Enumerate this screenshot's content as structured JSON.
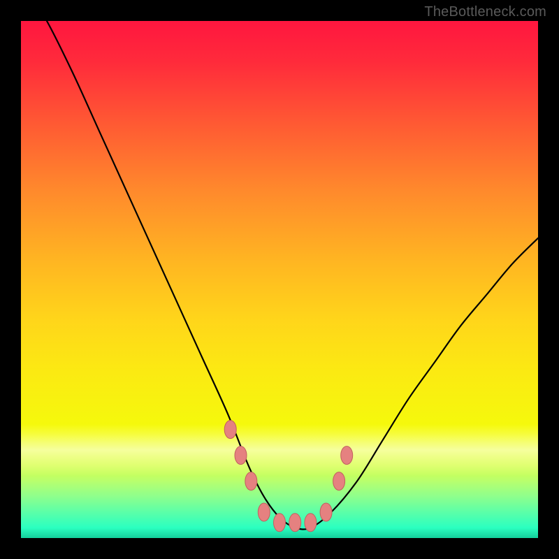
{
  "watermark": {
    "text": "TheBottleneck.com"
  },
  "colors": {
    "curve_stroke": "#000000",
    "marker_fill": "#e58180",
    "marker_stroke": "#c25f5e",
    "background_frame": "#000000"
  },
  "chart_data": {
    "type": "line",
    "title": "",
    "xlabel": "",
    "ylabel": "",
    "xlim": [
      0,
      100
    ],
    "ylim": [
      0,
      100
    ],
    "grid": false,
    "legend": false,
    "series": [
      {
        "name": "bottleneck-curve",
        "x": [
          0,
          5,
          10,
          15,
          20,
          25,
          30,
          35,
          40,
          44,
          47,
          50,
          53,
          56,
          60,
          65,
          70,
          75,
          80,
          85,
          90,
          95,
          100
        ],
        "values": [
          108,
          100,
          90,
          79,
          68,
          57,
          46,
          35,
          24,
          14,
          8,
          4,
          2,
          2,
          5,
          11,
          19,
          27,
          34,
          41,
          47,
          53,
          58
        ]
      }
    ],
    "markers": [
      {
        "x": 40.5,
        "y": 21
      },
      {
        "x": 42.5,
        "y": 16
      },
      {
        "x": 44.5,
        "y": 11
      },
      {
        "x": 47.0,
        "y": 5
      },
      {
        "x": 50.0,
        "y": 3
      },
      {
        "x": 53.0,
        "y": 3
      },
      {
        "x": 56.0,
        "y": 3
      },
      {
        "x": 59.0,
        "y": 5
      },
      {
        "x": 61.5,
        "y": 11
      },
      {
        "x": 63.0,
        "y": 16
      }
    ]
  }
}
